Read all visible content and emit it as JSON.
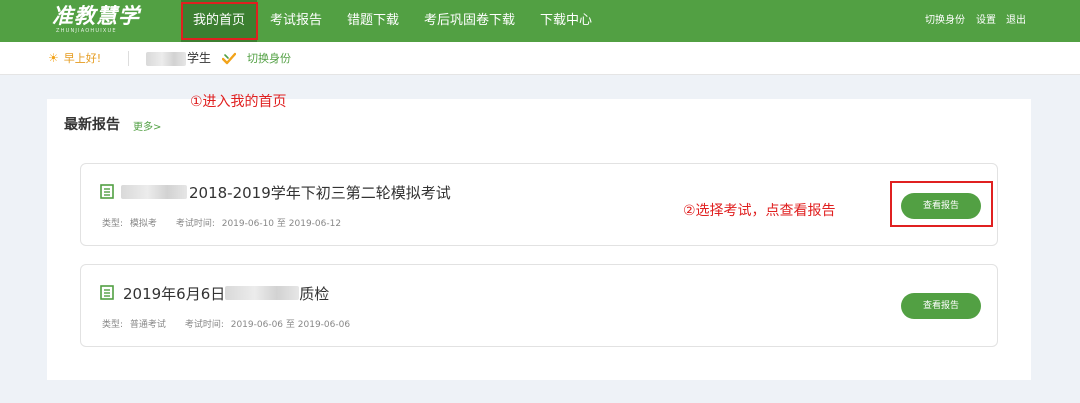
{
  "logo": {
    "main": "准教慧学",
    "sub": "ZHUNJIAOHUIXUE"
  },
  "nav": {
    "items": [
      "我的首页",
      "考试报告",
      "错题下载",
      "考后巩固卷下载",
      "下载中心"
    ],
    "right": [
      "切换身份",
      "设置",
      "退出"
    ]
  },
  "greeting": {
    "text": "早上好!",
    "role": "学生",
    "switch": "切换身份"
  },
  "section": {
    "title": "最新报告",
    "more": "更多>"
  },
  "reports": [
    {
      "title": "2018-2019学年下初三第二轮模拟考试",
      "type_label": "类型:",
      "type": "模拟考",
      "time_label": "考试时间:",
      "time": "2019-06-10 至 2019-06-12",
      "button": "查看报告"
    },
    {
      "title_prefix": "2019年6月6日",
      "title_suffix": "质检",
      "type_label": "类型:",
      "type": "普通考试",
      "time_label": "考试时间:",
      "time": "2019-06-06 至 2019-06-06",
      "button": "查看报告"
    }
  ],
  "annotations": {
    "step1": "①进入我的首页",
    "step2": "②选择考试，点查看报告"
  },
  "colors": {
    "brand": "#52a043",
    "nav_active": "#3c7f31",
    "annotation": "#e02020",
    "greeting": "#e59b1e"
  }
}
